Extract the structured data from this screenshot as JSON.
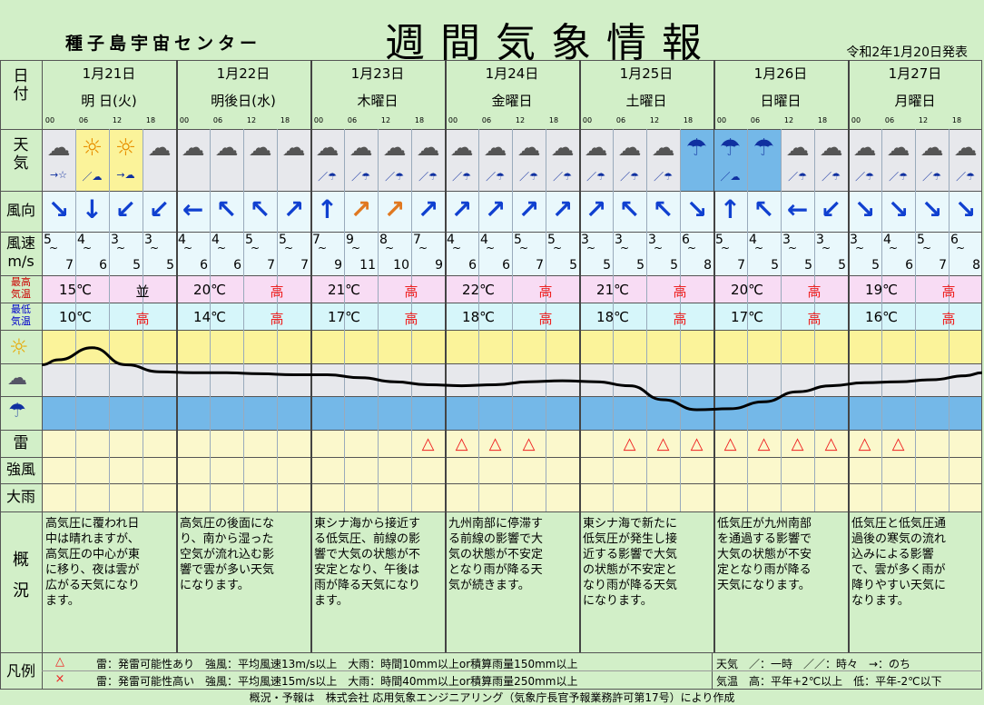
{
  "header": {
    "org": "種子島宇宙センター",
    "title": "週間気象情報",
    "issued": "令和2年1月20日発表"
  },
  "row_labels": {
    "date": "日付",
    "weather": "天気",
    "wind_dir": "風向",
    "wind_speed": "風速",
    "wind_unit": "m/s",
    "max_temp": "最高気温",
    "min_temp": "最低気温",
    "thunder": "雷",
    "strong_wind": "強風",
    "heavy_rain": "大雨",
    "summary": "概況",
    "legend": "凡例"
  },
  "days": [
    {
      "date": "1月21日",
      "weekday": "明 日(火)",
      "max": "15℃",
      "max_trend": "並",
      "min": "10℃",
      "min_trend": "高"
    },
    {
      "date": "1月22日",
      "weekday": "明後日(水)",
      "max": "20℃",
      "max_trend": "高",
      "min": "14℃",
      "min_trend": "高"
    },
    {
      "date": "1月23日",
      "weekday": "木曜日",
      "max": "21℃",
      "max_trend": "高",
      "min": "17℃",
      "min_trend": "高"
    },
    {
      "date": "1月24日",
      "weekday": "金曜日",
      "max": "22℃",
      "max_trend": "高",
      "min": "18℃",
      "min_trend": "高"
    },
    {
      "date": "1月25日",
      "weekday": "土曜日",
      "max": "21℃",
      "max_trend": "高",
      "min": "18℃",
      "min_trend": "高"
    },
    {
      "date": "1月26日",
      "weekday": "日曜日",
      "max": "20℃",
      "max_trend": "高",
      "min": "17℃",
      "min_trend": "高"
    },
    {
      "date": "1月27日",
      "weekday": "月曜日",
      "max": "19℃",
      "max_trend": "高",
      "min": "16℃",
      "min_trend": "高"
    }
  ],
  "hours": [
    "00",
    "06",
    "12",
    "18"
  ],
  "slots": {
    "weather": [
      "cloud",
      "sun",
      "sun",
      "cloud",
      "cloud",
      "cloud",
      "cloud",
      "cloud",
      "cloud",
      "cloud",
      "cloud",
      "cloud",
      "cloud",
      "cloud",
      "cloud",
      "cloud",
      "cloud",
      "cloud",
      "cloud",
      "umbrella",
      "umbrella",
      "umbrella",
      "cloud",
      "cloud",
      "cloud",
      "cloud",
      "cloud",
      "cloud"
    ],
    "weather_note": [
      "→☆",
      "／☁",
      "→☁",
      "",
      "",
      "",
      "",
      "",
      "／☂",
      "／☂",
      "／☂",
      "／☂",
      "／☂",
      "／☂",
      "／☂",
      "／☂",
      "／☂",
      "／☂",
      "／☂",
      "",
      "／☁",
      "",
      "／☂",
      "／☂",
      "／☂",
      "／☂",
      "／☂",
      "／☂"
    ],
    "wind_dir": [
      "↘",
      "↓",
      "↙",
      "↙",
      "←",
      "↖",
      "↖",
      "↗",
      "↑",
      "↗",
      "↗",
      "↗",
      "↗",
      "↗",
      "↗",
      "↗",
      "↗",
      "↖",
      "↖",
      "↘",
      "↑",
      "↖",
      "←",
      "↙",
      "↘",
      "↘",
      "↘",
      "↘"
    ],
    "wind_hi": [
      "5",
      "4",
      "3",
      "3",
      "4",
      "4",
      "5",
      "5",
      "7",
      "9",
      "8",
      "7",
      "4",
      "4",
      "5",
      "5",
      "3",
      "3",
      "3",
      "6",
      "5",
      "4",
      "3",
      "3",
      "3",
      "4",
      "5",
      "6"
    ],
    "wind_lo": [
      "7",
      "6",
      "5",
      "5",
      "6",
      "6",
      "7",
      "7",
      "9",
      "11",
      "10",
      "9",
      "6",
      "6",
      "7",
      "5",
      "5",
      "5",
      "5",
      "8",
      "7",
      "5",
      "5",
      "5",
      "5",
      "6",
      "7",
      "8"
    ],
    "thunder": [
      "",
      "",
      "",
      "",
      "",
      "",
      "",
      "",
      "",
      "",
      "",
      "△",
      "△",
      "△",
      "△",
      "",
      "",
      "△",
      "△",
      "△",
      "△",
      "△",
      "△",
      "△",
      "△",
      "△",
      "",
      ""
    ]
  },
  "weather_curve": [
    0.3,
    0.18,
    0.35,
    0.42,
    0.43,
    0.43,
    0.44,
    0.45,
    0.45,
    0.48,
    0.52,
    0.55,
    0.56,
    0.55,
    0.52,
    0.51,
    0.52,
    0.56,
    0.7,
    0.8,
    0.79,
    0.72,
    0.62,
    0.56,
    0.53,
    0.52,
    0.5,
    0.46
  ],
  "summaries": [
    "高気圧に覆われ日\n中は晴れますが、\n高気圧の中心が東\nに移り、夜は雲が\n広がる天気になり\nます。",
    "高気圧の後面にな\nり、南から湿った\n空気が流れ込む影\n響で雲が多い天気\nになります。",
    "東シナ海から接近す\nる低気圧、前線の影\n響で大気の状態が不\n安定となり、午後は\n雨が降る天気になり\nます。",
    "九州南部に停滞す\nる前線の影響で大\n気の状態が不安定\nとなり雨が降る天\n気が続きます。",
    "東シナ海で新たに\n低気圧が発生し接\n近する影響で大気\nの状態が不安定と\nなり雨が降る天気\nになります。",
    "低気圧が九州南部\nを通過する影響で\n大気の状態が不安\n定となり雨が降る\n天気になります。",
    "低気圧と低気圧通\n過後の寒気の流れ\n込みによる影響\nで、雲が多く雨が\n降りやすい天気に\nなります。"
  ],
  "legend": {
    "sym1": "△",
    "sym2": "×",
    "l1a": "雷：発雷可能性あり　強風：平均風速13m/s以上　大雨：時間10mm以上or積算雨量150mm以上",
    "l2a": "雷：発雷可能性高い　強風：平均風速15m/s以上　大雨：時間40mm以上or積算雨量250mm以上",
    "l1b": "天気　／：一時　／／：時々　→：のち",
    "l2b": "気温　高：平年+2℃以上　低：平年-2℃以下",
    "footer": "概況・予報は　株式会社 応用気象エンジニアリング（気象庁長官予報業務許可第17号）により作成"
  },
  "colors": {
    "bg": "#d2efc8",
    "sun": "#fbf39a",
    "cloud": "#e7e8ec",
    "rain": "#74b8e8",
    "light": "#e9f8fc",
    "max_row": "#f8dcf4",
    "min_row": "#d6f6fa",
    "thunder_row": "#fbf8cc",
    "trend": "#e22",
    "thunder": "#e22"
  }
}
